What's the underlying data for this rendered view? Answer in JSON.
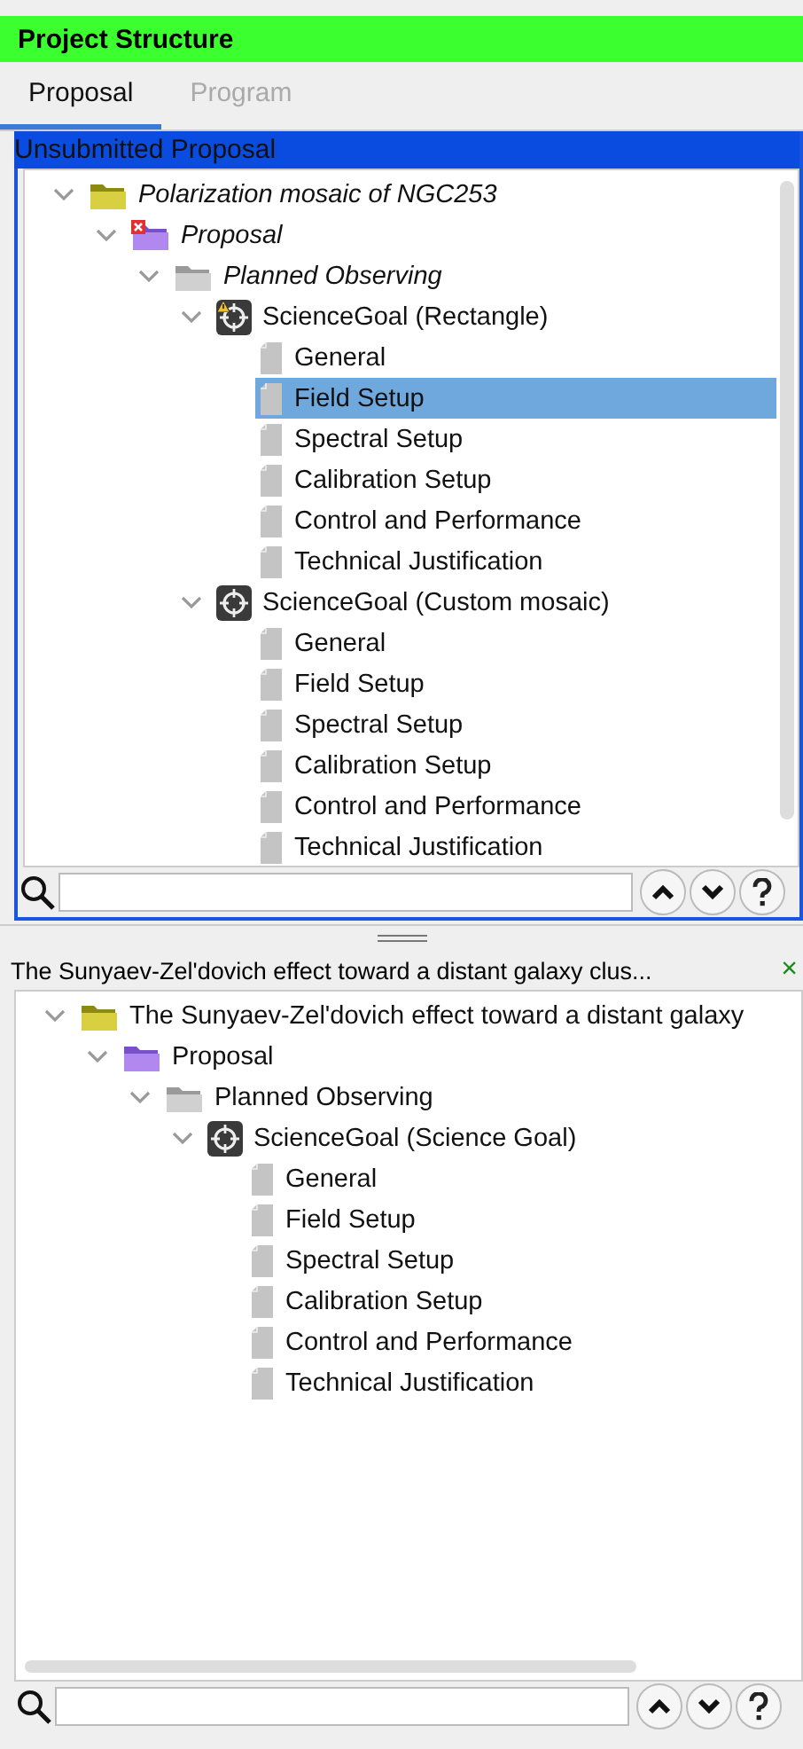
{
  "window": {
    "title": "Project Structure"
  },
  "tabs": [
    {
      "label": "Proposal",
      "selected": true
    },
    {
      "label": "Program",
      "selected": false
    }
  ],
  "proposal_panel": {
    "header": "Unsubmitted Proposal",
    "tree": [
      {
        "label": "Polarization mosaic of NGC253",
        "kind": "project",
        "italic": true,
        "error": false,
        "warning": false,
        "expanded": true,
        "selected": false,
        "children": [
          {
            "label": "Proposal",
            "kind": "proposal",
            "italic": true,
            "error": true,
            "warning": false,
            "expanded": true,
            "selected": false,
            "children": [
              {
                "label": "Planned Observing",
                "kind": "group",
                "italic": true,
                "error": false,
                "warning": false,
                "expanded": true,
                "selected": false,
                "children": [
                  {
                    "label": "ScienceGoal (Rectangle)",
                    "kind": "goal",
                    "italic": false,
                    "error": false,
                    "warning": true,
                    "expanded": true,
                    "selected": false,
                    "children": [
                      {
                        "label": "General",
                        "kind": "page",
                        "italic": false,
                        "selected": false
                      },
                      {
                        "label": "Field Setup",
                        "kind": "page",
                        "italic": false,
                        "selected": true
                      },
                      {
                        "label": "Spectral Setup",
                        "kind": "page",
                        "italic": false,
                        "selected": false
                      },
                      {
                        "label": "Calibration Setup",
                        "kind": "page",
                        "italic": false,
                        "selected": false
                      },
                      {
                        "label": "Control and Performance",
                        "kind": "page",
                        "italic": false,
                        "selected": false
                      },
                      {
                        "label": "Technical Justification",
                        "kind": "page",
                        "italic": false,
                        "selected": false
                      }
                    ]
                  },
                  {
                    "label": "ScienceGoal (Custom mosaic)",
                    "kind": "goal",
                    "italic": false,
                    "error": false,
                    "warning": false,
                    "expanded": true,
                    "selected": false,
                    "children": [
                      {
                        "label": "General",
                        "kind": "page",
                        "italic": false,
                        "selected": false
                      },
                      {
                        "label": "Field Setup",
                        "kind": "page",
                        "italic": false,
                        "selected": false
                      },
                      {
                        "label": "Spectral Setup",
                        "kind": "page",
                        "italic": false,
                        "selected": false
                      },
                      {
                        "label": "Calibration Setup",
                        "kind": "page",
                        "italic": false,
                        "selected": false
                      },
                      {
                        "label": "Control and Performance",
                        "kind": "page",
                        "italic": false,
                        "selected": false
                      },
                      {
                        "label": "Technical Justification",
                        "kind": "page",
                        "italic": false,
                        "selected": false
                      }
                    ]
                  }
                ]
              }
            ]
          }
        ]
      }
    ]
  },
  "open_panel": {
    "header": "The Sunyaev-Zel'dovich effect toward a distant galaxy clus...",
    "close": "×",
    "tree": [
      {
        "label": "The Sunyaev-Zel'dovich effect toward a distant galaxy",
        "kind": "project",
        "italic": false,
        "expanded": true,
        "selected": false,
        "children": [
          {
            "label": "Proposal",
            "kind": "proposal",
            "italic": false,
            "expanded": true,
            "selected": false,
            "children": [
              {
                "label": "Planned Observing",
                "kind": "group",
                "italic": false,
                "expanded": true,
                "selected": false,
                "children": [
                  {
                    "label": "ScienceGoal (Science Goal)",
                    "kind": "goal",
                    "italic": false,
                    "expanded": true,
                    "selected": false,
                    "children": [
                      {
                        "label": "General",
                        "kind": "page",
                        "italic": false,
                        "selected": false
                      },
                      {
                        "label": "Field Setup",
                        "kind": "page",
                        "italic": false,
                        "selected": false
                      },
                      {
                        "label": "Spectral Setup",
                        "kind": "page",
                        "italic": false,
                        "selected": false
                      },
                      {
                        "label": "Calibration Setup",
                        "kind": "page",
                        "italic": false,
                        "selected": false
                      },
                      {
                        "label": "Control and Performance",
                        "kind": "page",
                        "italic": false,
                        "selected": false
                      },
                      {
                        "label": "Technical Justification",
                        "kind": "page",
                        "italic": false,
                        "selected": false
                      }
                    ]
                  }
                ]
              }
            ]
          }
        ]
      }
    ]
  }
}
